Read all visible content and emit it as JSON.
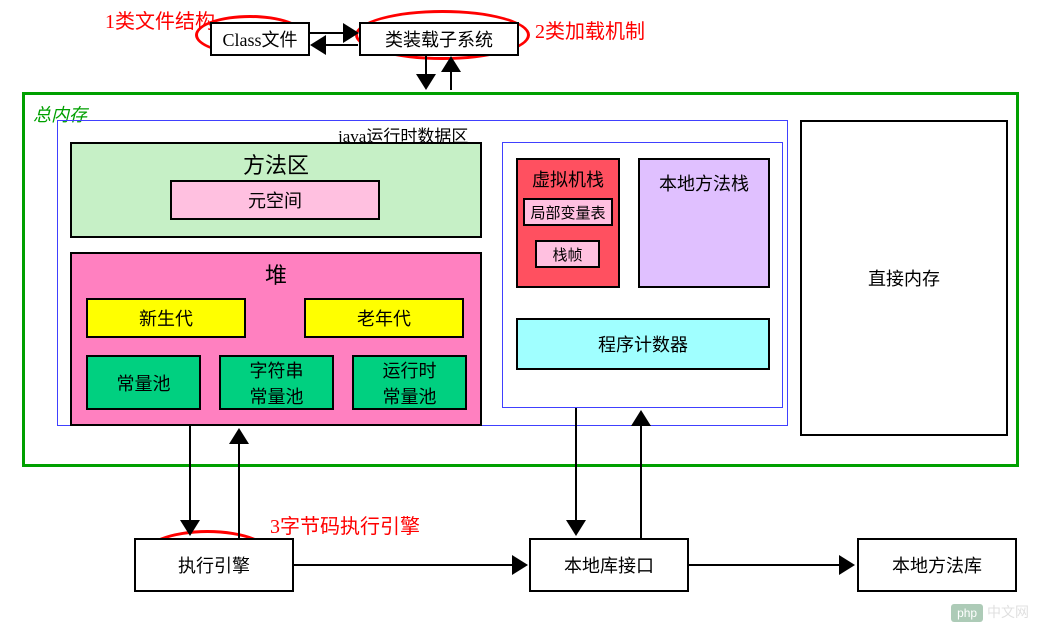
{
  "annotations": {
    "anno1": "1类文件结构",
    "anno2": "2类加载机制",
    "anno3": "3字节码执行引擎"
  },
  "top": {
    "classFile": "Class文件",
    "classLoader": "类装载子系统"
  },
  "memory": {
    "outerLabel": "总内存",
    "runtimeLabel": "java运行时数据区",
    "methodArea": {
      "title": "方法区",
      "metaspace": "元空间"
    },
    "heap": {
      "title": "堆",
      "youngGen": "新生代",
      "oldGen": "老年代",
      "constPool": "常量池",
      "stringPool": "字符串\n常量池",
      "runtimePool": "运行时\n常量池"
    },
    "vmStack": {
      "title": "虚拟机栈",
      "localVars": "局部变量表",
      "stackFrame": "栈帧"
    },
    "nativeStack": "本地方法栈",
    "pc": "程序计数器",
    "directMem": "直接内存"
  },
  "bottom": {
    "execEngine": "执行引擎",
    "nativeLibInterface": "本地库接口",
    "nativeMethodLib": "本地方法库"
  },
  "watermark": "中文网"
}
